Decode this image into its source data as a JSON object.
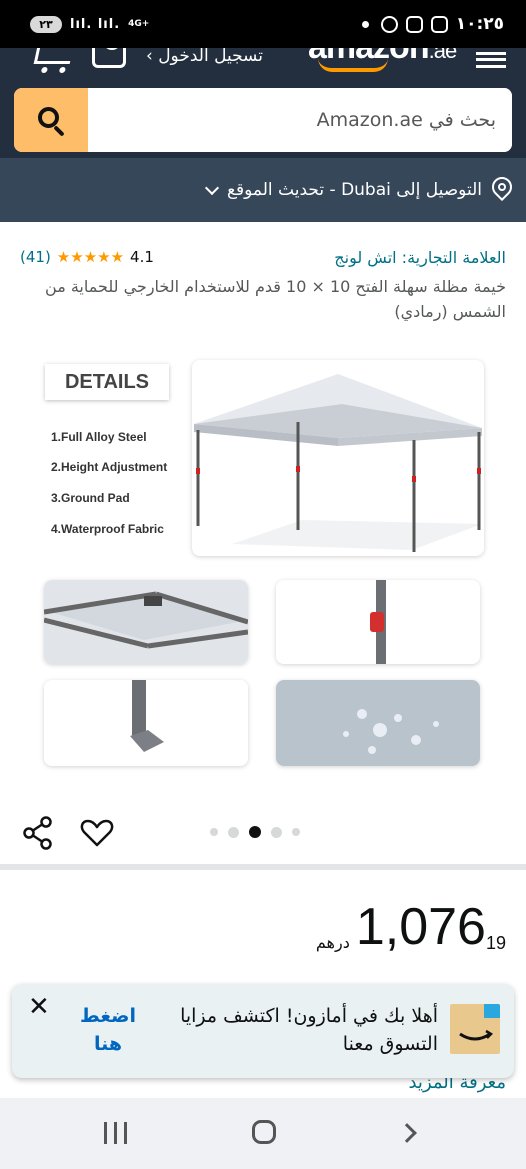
{
  "status_bar": {
    "time": "١٠:٢٥",
    "battery": "٢٣",
    "network": "4G+"
  },
  "header": {
    "logo_text": "amazon",
    "logo_tld": ".ae",
    "signin_label": "تسجيل الدخول ›",
    "search_placeholder": "بحث في Amazon.ae",
    "location_text": "التوصيل إلى Dubai - تحديث الموقع"
  },
  "product": {
    "brand": "العلامة التجارية: اتش لونج",
    "rating_value": "4.1",
    "rating_stars": "★★★★★",
    "rating_count": "(41)",
    "title": "خيمة مظلة سهلة الفتح 10 × 10 قدم للاستخدام الخارجي للحماية من الشمس (رمادي)"
  },
  "gallery": {
    "details_heading": "DETAILS",
    "features": [
      "1.Full Alloy Steel",
      "2.Height Adjustment",
      "3.Ground Pad",
      "4.Waterproof Fabric"
    ],
    "dots_count": 5,
    "active_dot": 3
  },
  "price": {
    "currency": "درهم",
    "whole": "1,076",
    "fraction": "19"
  },
  "learn_more": "معرفة المزيد",
  "banner": {
    "text": "أهلا بك في أمازون! اكتشف مزايا التسوق معنا",
    "cta": "اضغط هنا",
    "close": "✕"
  },
  "colors": {
    "header_bg": "#232f3e",
    "location_bg": "#37475a",
    "search_button": "#febd69",
    "link": "#007185",
    "star": "#ff9900"
  }
}
